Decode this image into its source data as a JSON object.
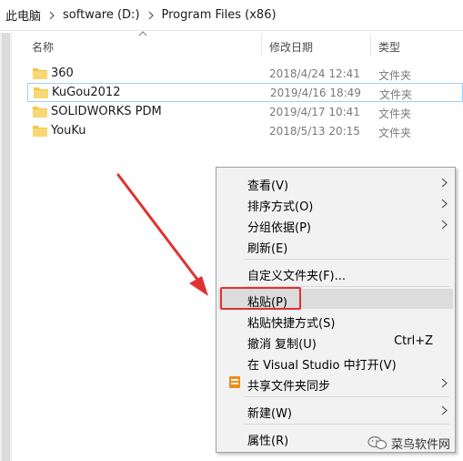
{
  "breadcrumb": [
    "此电脑",
    "software (D:)",
    "Program Files (x86)"
  ],
  "columns": {
    "name": "名称",
    "date": "修改日期",
    "type": "类型"
  },
  "files": [
    {
      "name": "360",
      "date": "2018/4/24 12:41",
      "type": "文件夹"
    },
    {
      "name": "KuGou2012",
      "date": "2019/4/16 18:49",
      "type": "文件夹"
    },
    {
      "name": "SOLIDWORKS PDM",
      "date": "2019/4/17 10:41",
      "type": "文件夹"
    },
    {
      "name": "YouKu",
      "date": "2018/5/13 20:15",
      "type": "文件夹"
    }
  ],
  "menu": {
    "view": "查看(V)",
    "sort": "排序方式(O)",
    "group": "分组依据(P)",
    "refresh": "刷新(E)",
    "customize": "自定义文件夹(F)...",
    "paste": "粘贴(P)",
    "paste_shortcut": "粘贴快捷方式(S)",
    "undo": "撤消 复制(U)",
    "undo_shortcut": "Ctrl+Z",
    "open_vs": "在 Visual Studio 中打开(V)",
    "share_sync": "共享文件夹同步",
    "new": "新建(W)",
    "properties": "属性(R)"
  },
  "watermark": "菜鸟软件网",
  "colors": {
    "folder": "#f4c54a",
    "highlight": "#e03131",
    "selection_border": "#99d1ff",
    "menu_bg": "#f2f2f2"
  }
}
